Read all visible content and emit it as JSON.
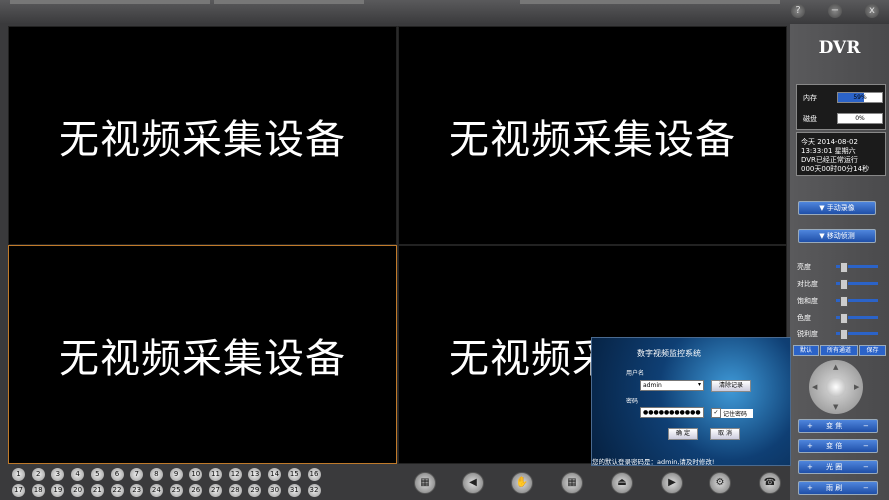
{
  "window": {
    "help_label": "?",
    "minimize_label": "−",
    "close_label": "x"
  },
  "video": {
    "cells": [
      "无视频采集设备",
      "无视频采集设备",
      "无视频采集设备",
      "无视频采集设备"
    ],
    "selected_cell": 3
  },
  "sidebar": {
    "logo": "DVR",
    "memory": {
      "label": "内存",
      "value": "59%",
      "fraction": 0.59
    },
    "disk": {
      "label": "磁盘",
      "value": "0%",
      "fraction": 0.0
    },
    "info": {
      "line1": "今天  2014-08-02",
      "line2": "13:33:01 星期六",
      "line3": "DVR已经正常运行",
      "line4": "000天00时00分14秒"
    },
    "manual_record": "▼ 手动录像",
    "motion_detect": "▼ 移动侦测",
    "adjust": [
      {
        "label": "亮度",
        "level": 0.1
      },
      {
        "label": "对比度",
        "level": 0.1
      },
      {
        "label": "饱和度",
        "level": 0.1
      },
      {
        "label": "色度",
        "level": 0.1
      },
      {
        "label": "锐利度",
        "level": 0.1
      }
    ],
    "default_btn": "默认",
    "all_channels_btn": "所有通道",
    "save_btn": "保存",
    "ptz_controls": [
      {
        "plus": "+",
        "label": "变 焦",
        "minus": "−"
      },
      {
        "plus": "+",
        "label": "变 倍",
        "minus": "−"
      },
      {
        "plus": "+",
        "label": "光 圈",
        "minus": "−"
      },
      {
        "plus": "+",
        "label": "雨 刷",
        "minus": "−"
      }
    ]
  },
  "channels_row1": [
    "1",
    "2",
    "3",
    "4",
    "5",
    "6",
    "7",
    "8",
    "9",
    "10",
    "11",
    "12",
    "13",
    "14",
    "15",
    "16"
  ],
  "channels_row2": [
    "17",
    "18",
    "19",
    "20",
    "21",
    "22",
    "23",
    "24",
    "25",
    "26",
    "27",
    "28",
    "29",
    "30",
    "31",
    "32"
  ],
  "toolbar_icons": [
    "grid-layout-icon",
    "speaker-icon",
    "hand-icon",
    "multi-grid-icon",
    "eject-icon",
    "playback-icon",
    "settings-icon",
    "phone-icon"
  ],
  "toolbar_glyphs": [
    "▦",
    "◀",
    "✋",
    "▦",
    "⏏",
    "▶",
    "⚙",
    "☎"
  ],
  "login": {
    "title": "数字视频监控系统",
    "username_label": "用户名",
    "username_value": "admin",
    "clear_btn": "清除记录",
    "password_label": "密码",
    "password_value": "●●●●●●●●●●●",
    "remember_label": "记住密码",
    "confirm_btn": "确 定",
    "cancel_btn": "取 消",
    "footer": "您的默认登录密码是：admin,请及时修改!"
  }
}
